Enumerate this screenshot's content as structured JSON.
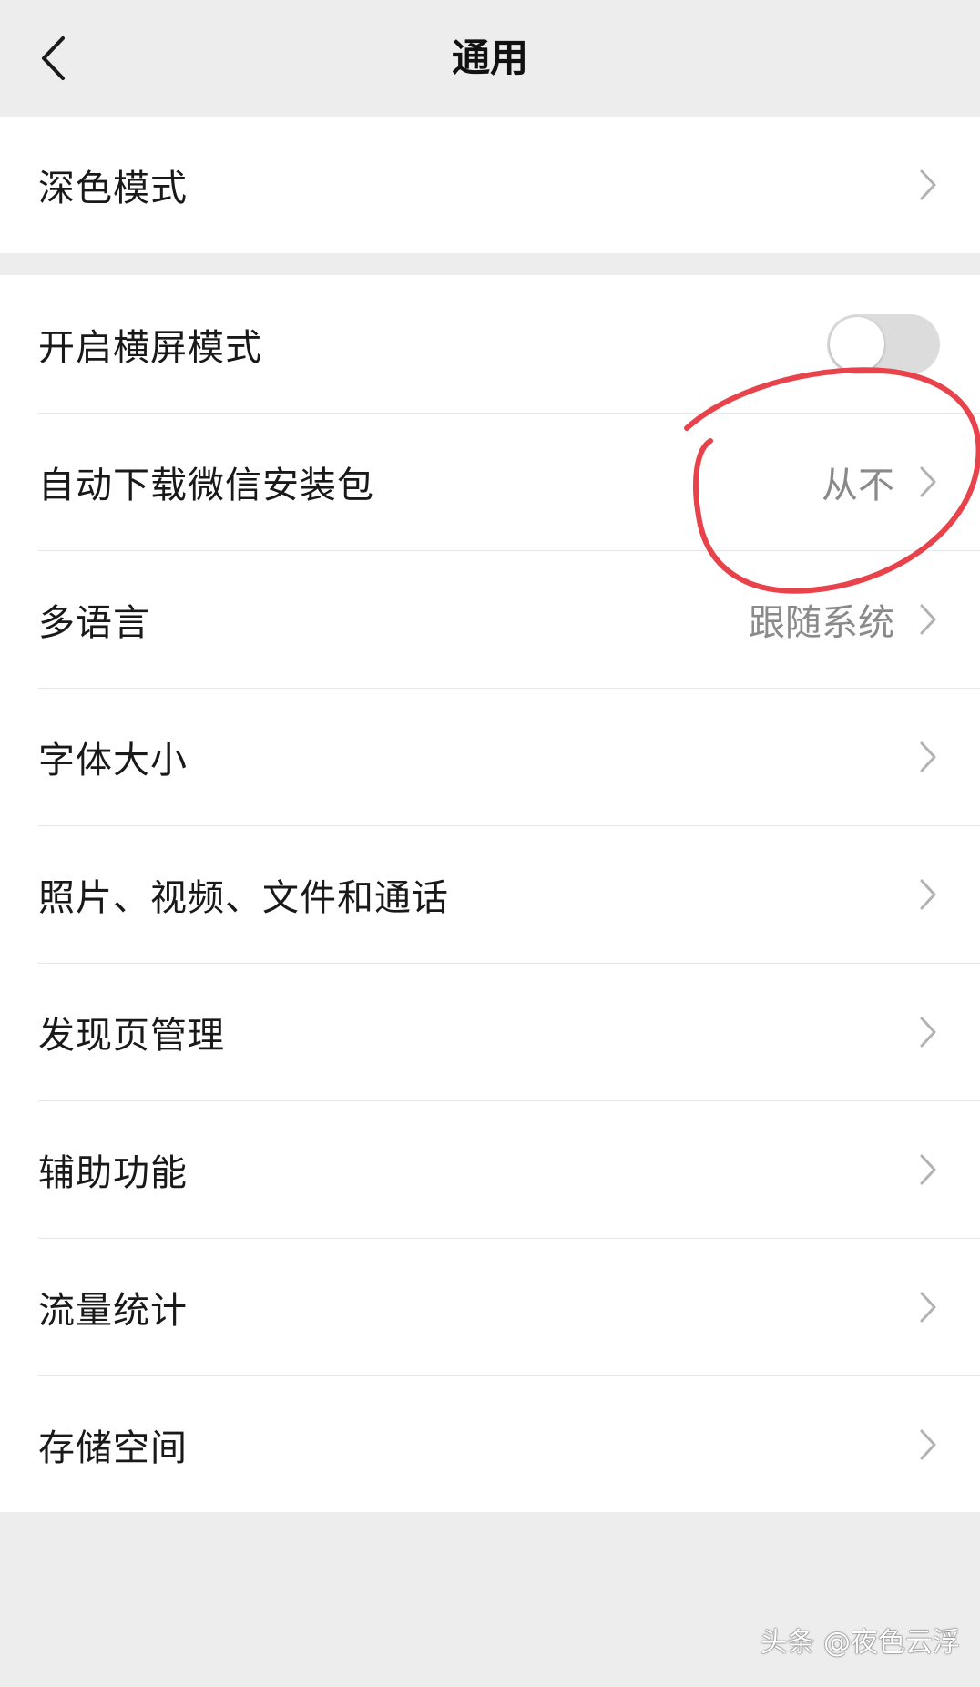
{
  "header": {
    "title": "通用",
    "back_icon": "chevron-left-icon"
  },
  "groups": [
    {
      "items": [
        {
          "label": "深色模式",
          "type": "link"
        }
      ]
    },
    {
      "items": [
        {
          "label": "开启横屏模式",
          "type": "toggle",
          "toggle_on": false
        },
        {
          "label": "自动下载微信安装包",
          "type": "link",
          "value": "从不"
        },
        {
          "label": "多语言",
          "type": "link",
          "value": "跟随系统"
        },
        {
          "label": "字体大小",
          "type": "link"
        },
        {
          "label": "照片、视频、文件和通话",
          "type": "link"
        },
        {
          "label": "发现页管理",
          "type": "link"
        },
        {
          "label": "辅助功能",
          "type": "link"
        },
        {
          "label": "流量统计",
          "type": "link"
        },
        {
          "label": "存储空间",
          "type": "link"
        }
      ]
    }
  ],
  "annotation": {
    "shape": "hand-drawn-circle",
    "color": "#e8434a"
  },
  "watermark": "头条 @夜色云浮",
  "colors": {
    "background": "#ededed",
    "card": "#ffffff",
    "text": "#191919",
    "secondary_text": "#8a8a8a",
    "chevron": "#b2b2b2",
    "toggle_off": "#dcdcdc"
  }
}
